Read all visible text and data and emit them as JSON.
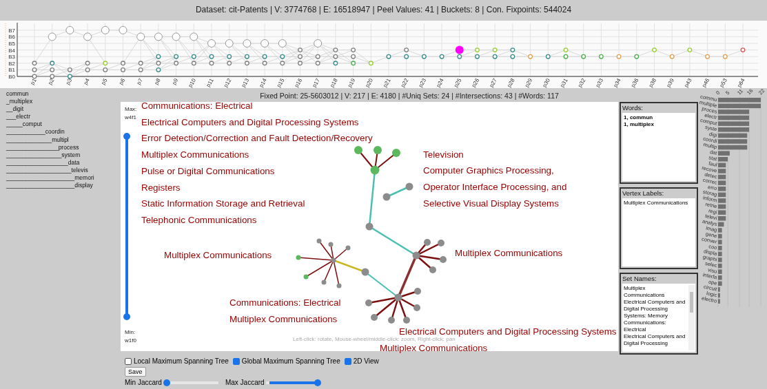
{
  "header": "Dataset: cit-Patents | V: 3774768 | E: 16518947 | Peel Values: 41 | Buckets: 8 | Con. Fixpoints: 544024",
  "peel_chart": {
    "y_labels": [
      "B7",
      "B6",
      "B5",
      "B4",
      "B3",
      "B2",
      "B1",
      "B0"
    ],
    "x_labels": [
      "p1",
      "p2",
      "p3",
      "p4",
      "p5",
      "p6",
      "p7",
      "p8",
      "p9",
      "p10",
      "p11",
      "p12",
      "p13",
      "p14",
      "p15",
      "p16",
      "p17",
      "p18",
      "p19",
      "p20",
      "p21",
      "p22",
      "p23",
      "p24",
      "p25",
      "p26",
      "p27",
      "p28",
      "p29",
      "p30",
      "p31",
      "p32",
      "p33",
      "p34",
      "p36",
      "p38",
      "p39",
      "p43",
      "p46",
      "p53",
      "p64"
    ]
  },
  "word_tree": [
    "commun",
    "_multiplex",
    "__digit",
    "___electr",
    "_____comput",
    "____________coordin",
    "______________multipl",
    "________________process",
    "_________________system",
    "___________________data",
    "____________________televis",
    "_____________________memori",
    "_____________________display"
  ],
  "fixed_point_title": "Fixed Point: 25-5603012 | V: 217 | E: 4180 | #Uniq Sets: 24 | #Intersections: 43 | #Words: 117",
  "weight_slider": {
    "max_label": "Max:",
    "max_value": "w4f1",
    "min_label": "Min:",
    "min_value": "w1f0",
    "level": 1
  },
  "category_labels": [
    "Communications: Electrical",
    "Electrical Computers and Digital Processing Systems",
    "Error Detection/Correction and Fault Detection/Recovery",
    "Multiplex Communications",
    "Pulse or Digital Communications",
    "Registers",
    "Static Information Storage and Retrieval",
    "Telephonic Communications"
  ],
  "graph_labels": [
    "Television",
    "Computer Graphics Processing,\nOperator Interface Processing, and\nSelective Visual Display Systems",
    "Multiplex Communications",
    "Multiplex Communications",
    "Communications: Electrical",
    "Multiplex Communications",
    "Electrical Computers and Digital Processing Systems",
    "Multiplex Communications"
  ],
  "hint": "Left-click: rotate, Mouse-wheel/middle-click: zoom, Right-click: pan",
  "panels": [
    {
      "title": "Words:",
      "kind": "bold",
      "lines": [
        "1, commun",
        "1, multiplex"
      ]
    },
    {
      "title": "Vertex Labels:",
      "kind": "plain",
      "lines": [
        "Multiplex Communications"
      ]
    },
    {
      "title": "Set Names:",
      "kind": "scroll",
      "lines": [
        "Multiplex Communications",
        "Electrical Computers and Digital Processing Systems: Memory",
        "Communications: Electrical",
        "Electrical Computers and Digital Processing"
      ]
    }
  ],
  "word_counts": {
    "chart_data": {
      "type": "bar",
      "orientation": "horizontal",
      "categories": [
        "commu",
        "multiple",
        "proces",
        "electr",
        "comput",
        "syste",
        "digi",
        "coordi",
        "multip",
        "dat",
        "stat",
        "faul",
        "recove",
        "detec",
        "correc",
        "erro",
        "storag",
        "inform",
        "retrie",
        "regi",
        "televi",
        "analys",
        "imag",
        "gene",
        "conver",
        "coo",
        "displa",
        "graphi",
        "selec",
        "visu",
        "interfa",
        "ope",
        "circuit",
        "logic",
        "electro"
      ],
      "values": [
        22,
        22,
        16,
        16,
        16,
        16,
        15,
        15,
        15,
        6,
        5,
        4,
        4,
        4,
        4,
        4,
        4,
        4,
        4,
        4,
        4,
        3,
        2,
        2,
        2,
        2,
        2,
        2,
        2,
        2,
        2,
        2,
        1,
        1,
        1
      ],
      "xlim": [
        0,
        22
      ],
      "xticks": [
        0,
        5,
        11,
        16,
        22
      ],
      "grid": true
    }
  },
  "checkboxes": [
    {
      "label": "Local Maximum Spanning Tree",
      "checked": false
    },
    {
      "label": "Global Maximum Spanning Tree",
      "checked": true
    },
    {
      "label": "2D View",
      "checked": true
    }
  ],
  "save_button": "Save",
  "sliders": [
    {
      "label": "Min Jaccard",
      "level": 0
    },
    {
      "label": "Max Jaccard",
      "level": 1
    }
  ]
}
